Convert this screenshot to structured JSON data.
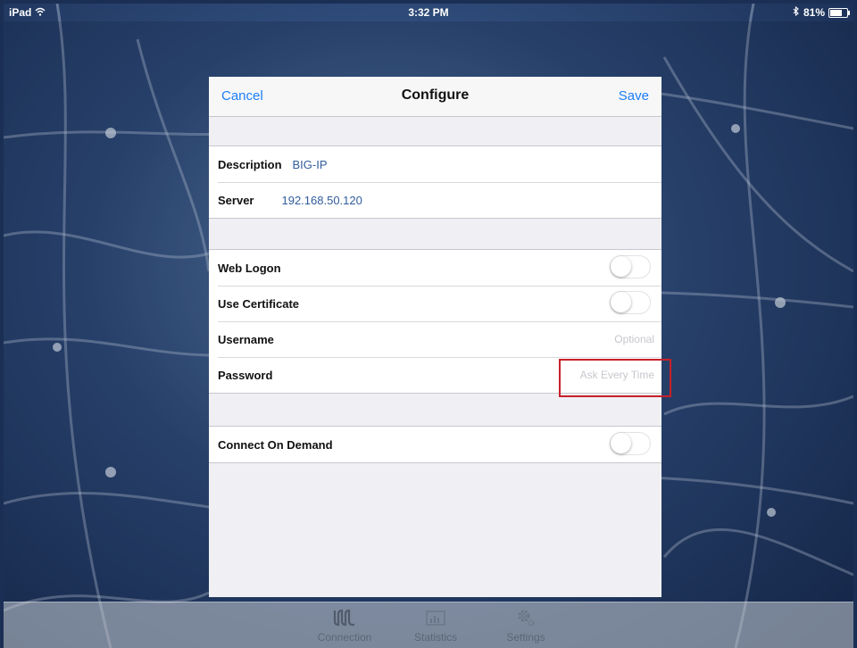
{
  "status_bar": {
    "device": "iPad",
    "time": "3:32 PM",
    "battery": "81%",
    "battery_level": 0.81
  },
  "nav": {
    "cancel_label": "Cancel",
    "title": "Configure",
    "save_label": "Save"
  },
  "server_section": {
    "description_label": "Description",
    "description_value": "BIG-IP",
    "server_label": "Server",
    "server_value": "192.168.50.120"
  },
  "auth_section": {
    "web_logon_label": "Web Logon",
    "web_logon_on": false,
    "use_certificate_label": "Use Certificate",
    "use_certificate_on": false,
    "username_label": "Username",
    "username_placeholder": "Optional",
    "password_label": "Password",
    "password_placeholder": "Ask Every Time"
  },
  "demand_section": {
    "connect_on_demand_label": "Connect On Demand",
    "connect_on_demand_on": false
  },
  "tab_bar": {
    "tabs": [
      {
        "label": "Connection",
        "icon": "connection-icon"
      },
      {
        "label": "Statistics",
        "icon": "statistics-icon"
      },
      {
        "label": "Settings",
        "icon": "gear-icon"
      }
    ]
  },
  "colors": {
    "accent": "#1c7ef6",
    "value_text": "#315c9c",
    "highlight_box": "#c8202a"
  }
}
